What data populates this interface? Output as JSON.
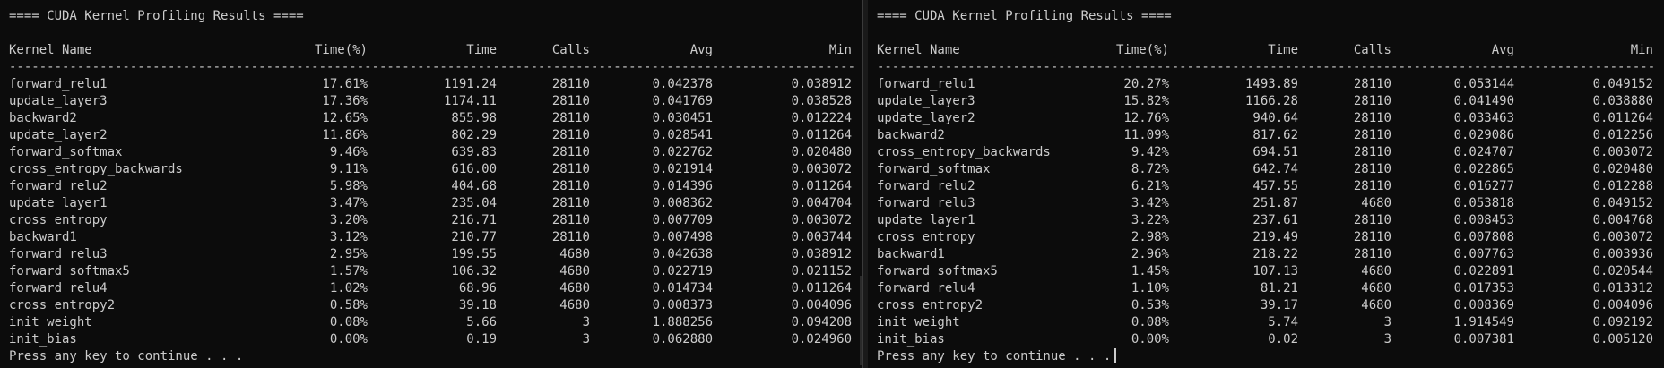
{
  "panes": [
    {
      "title": "==== CUDA Kernel Profiling Results ====",
      "headers": {
        "name": "Kernel Name",
        "time_pct": "Time(%)",
        "time": "Time",
        "calls": "Calls",
        "avg": "Avg",
        "min": "Min"
      },
      "rule": "-----------------------------------------------------------------------------------------------------------------------------------------------",
      "rows": [
        {
          "name": "forward_relu1",
          "time_pct": "17.61%",
          "time": "1191.24",
          "calls": "28110",
          "avg": "0.042378",
          "min": "0.038912"
        },
        {
          "name": "update_layer3",
          "time_pct": "17.36%",
          "time": "1174.11",
          "calls": "28110",
          "avg": "0.041769",
          "min": "0.038528"
        },
        {
          "name": "backward2",
          "time_pct": "12.65%",
          "time": "855.98",
          "calls": "28110",
          "avg": "0.030451",
          "min": "0.012224"
        },
        {
          "name": "update_layer2",
          "time_pct": "11.86%",
          "time": "802.29",
          "calls": "28110",
          "avg": "0.028541",
          "min": "0.011264"
        },
        {
          "name": "forward_softmax",
          "time_pct": "9.46%",
          "time": "639.83",
          "calls": "28110",
          "avg": "0.022762",
          "min": "0.020480"
        },
        {
          "name": "cross_entropy_backwards",
          "time_pct": "9.11%",
          "time": "616.00",
          "calls": "28110",
          "avg": "0.021914",
          "min": "0.003072"
        },
        {
          "name": "forward_relu2",
          "time_pct": "5.98%",
          "time": "404.68",
          "calls": "28110",
          "avg": "0.014396",
          "min": "0.011264"
        },
        {
          "name": "update_layer1",
          "time_pct": "3.47%",
          "time": "235.04",
          "calls": "28110",
          "avg": "0.008362",
          "min": "0.004704"
        },
        {
          "name": "cross_entropy",
          "time_pct": "3.20%",
          "time": "216.71",
          "calls": "28110",
          "avg": "0.007709",
          "min": "0.003072"
        },
        {
          "name": "backward1",
          "time_pct": "3.12%",
          "time": "210.77",
          "calls": "28110",
          "avg": "0.007498",
          "min": "0.003744"
        },
        {
          "name": "forward_relu3",
          "time_pct": "2.95%",
          "time": "199.55",
          "calls": "4680",
          "avg": "0.042638",
          "min": "0.038912"
        },
        {
          "name": "forward_softmax5",
          "time_pct": "1.57%",
          "time": "106.32",
          "calls": "4680",
          "avg": "0.022719",
          "min": "0.021152"
        },
        {
          "name": "forward_relu4",
          "time_pct": "1.02%",
          "time": "68.96",
          "calls": "4680",
          "avg": "0.014734",
          "min": "0.011264"
        },
        {
          "name": "cross_entropy2",
          "time_pct": "0.58%",
          "time": "39.18",
          "calls": "4680",
          "avg": "0.008373",
          "min": "0.004096"
        },
        {
          "name": "init_weight",
          "time_pct": "0.08%",
          "time": "5.66",
          "calls": "3",
          "avg": "1.888256",
          "min": "0.094208"
        },
        {
          "name": "init_bias",
          "time_pct": "0.00%",
          "time": "0.19",
          "calls": "3",
          "avg": "0.062880",
          "min": "0.024960"
        }
      ],
      "footer": "Press any key to continue . . ."
    },
    {
      "title": "==== CUDA Kernel Profiling Results ====",
      "headers": {
        "name": "Kernel Name",
        "time_pct": "Time(%)",
        "time": "Time",
        "calls": "Calls",
        "avg": "Avg",
        "min": "Min"
      },
      "rule": "-----------------------------------------------------------------------------------------------------------------------------------------------",
      "rows": [
        {
          "name": "forward_relu1",
          "time_pct": "20.27%",
          "time": "1493.89",
          "calls": "28110",
          "avg": "0.053144",
          "min": "0.049152"
        },
        {
          "name": "update_layer3",
          "time_pct": "15.82%",
          "time": "1166.28",
          "calls": "28110",
          "avg": "0.041490",
          "min": "0.038880"
        },
        {
          "name": "update_layer2",
          "time_pct": "12.76%",
          "time": "940.64",
          "calls": "28110",
          "avg": "0.033463",
          "min": "0.011264"
        },
        {
          "name": "backward2",
          "time_pct": "11.09%",
          "time": "817.62",
          "calls": "28110",
          "avg": "0.029086",
          "min": "0.012256"
        },
        {
          "name": "cross_entropy_backwards",
          "time_pct": "9.42%",
          "time": "694.51",
          "calls": "28110",
          "avg": "0.024707",
          "min": "0.003072"
        },
        {
          "name": "forward_softmax",
          "time_pct": "8.72%",
          "time": "642.74",
          "calls": "28110",
          "avg": "0.022865",
          "min": "0.020480"
        },
        {
          "name": "forward_relu2",
          "time_pct": "6.21%",
          "time": "457.55",
          "calls": "28110",
          "avg": "0.016277",
          "min": "0.012288"
        },
        {
          "name": "forward_relu3",
          "time_pct": "3.42%",
          "time": "251.87",
          "calls": "4680",
          "avg": "0.053818",
          "min": "0.049152"
        },
        {
          "name": "update_layer1",
          "time_pct": "3.22%",
          "time": "237.61",
          "calls": "28110",
          "avg": "0.008453",
          "min": "0.004768"
        },
        {
          "name": "cross_entropy",
          "time_pct": "2.98%",
          "time": "219.49",
          "calls": "28110",
          "avg": "0.007808",
          "min": "0.003072"
        },
        {
          "name": "backward1",
          "time_pct": "2.96%",
          "time": "218.22",
          "calls": "28110",
          "avg": "0.007763",
          "min": "0.003936"
        },
        {
          "name": "forward_softmax5",
          "time_pct": "1.45%",
          "time": "107.13",
          "calls": "4680",
          "avg": "0.022891",
          "min": "0.020544"
        },
        {
          "name": "forward_relu4",
          "time_pct": "1.10%",
          "time": "81.21",
          "calls": "4680",
          "avg": "0.017353",
          "min": "0.013312"
        },
        {
          "name": "cross_entropy2",
          "time_pct": "0.53%",
          "time": "39.17",
          "calls": "4680",
          "avg": "0.008369",
          "min": "0.004096"
        },
        {
          "name": "init_weight",
          "time_pct": "0.08%",
          "time": "5.74",
          "calls": "3",
          "avg": "1.914549",
          "min": "0.092192"
        },
        {
          "name": "init_bias",
          "time_pct": "0.00%",
          "time": "0.02",
          "calls": "3",
          "avg": "0.007381",
          "min": "0.005120"
        }
      ],
      "footer": "Press any key to continue . . ."
    }
  ]
}
